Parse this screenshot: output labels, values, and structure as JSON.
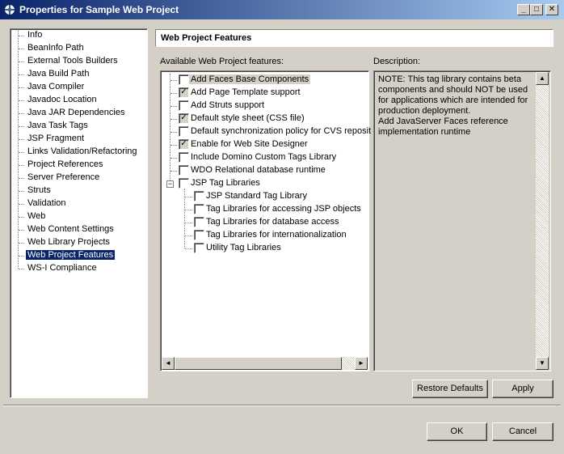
{
  "window": {
    "title": "Properties for Sample Web Project",
    "controls": {
      "minimize": "_",
      "maximize": "□",
      "close": "✕"
    }
  },
  "nav": {
    "items": [
      "Info",
      "BeanInfo Path",
      "External Tools Builders",
      "Java Build Path",
      "Java Compiler",
      "Javadoc Location",
      "Java JAR Dependencies",
      "Java Task Tags",
      "JSP Fragment",
      "Links Validation/Refactoring",
      "Project References",
      "Server Preference",
      "Struts",
      "Validation",
      "Web",
      "Web Content Settings",
      "Web Library Projects",
      "Web Project Features",
      "WS-I Compliance"
    ],
    "selected": "Web Project Features"
  },
  "page": {
    "title": "Web Project Features",
    "features_label": "Available Web Project features:",
    "description_label": "Description:",
    "description": "NOTE: This tag library contains beta\ncomponents and should NOT be used\nfor applications which are intended for\nproduction deployment.\nAdd JavaServer Faces reference\nimplementation runtime"
  },
  "features": [
    {
      "label": "Add Faces Base Components",
      "checked": false,
      "highlighted": true
    },
    {
      "label": "Add Page Template support",
      "checked": true
    },
    {
      "label": "Add Struts support",
      "checked": false
    },
    {
      "label": "Default style sheet (CSS file)",
      "checked": true
    },
    {
      "label": "Default synchronization policy for CVS reposit",
      "checked": false
    },
    {
      "label": "Enable for Web Site Designer",
      "checked": true
    },
    {
      "label": "Include Domino Custom Tags Library",
      "checked": false
    },
    {
      "label": "WDO Relational database runtime",
      "checked": false
    },
    {
      "label": "JSP Tag Libraries",
      "checked": false,
      "expanded": true,
      "expander": "−"
    }
  ],
  "jsp_children": [
    {
      "label": "JSP Standard Tag Library",
      "checked": false
    },
    {
      "label": "Tag Libraries for accessing JSP objects",
      "checked": false
    },
    {
      "label": "Tag Libraries for database access",
      "checked": false
    },
    {
      "label": "Tag Libraries for internationalization",
      "checked": false
    },
    {
      "label": "Utility Tag Libraries",
      "checked": false
    }
  ],
  "buttons": {
    "restore_defaults": "Restore Defaults",
    "apply": "Apply",
    "ok": "OK",
    "cancel": "Cancel"
  },
  "scroll": {
    "left": "◄",
    "right": "►",
    "up": "▲",
    "down": "▼"
  }
}
